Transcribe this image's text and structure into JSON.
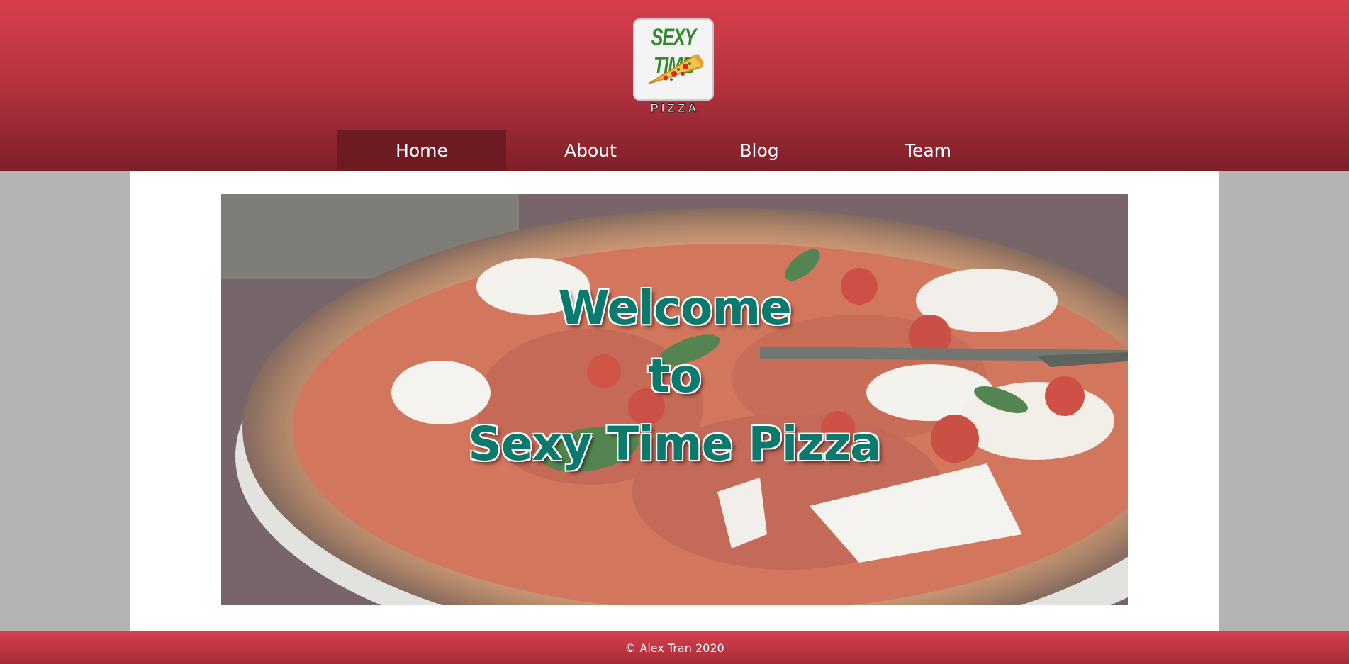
{
  "logo": {
    "top_text": "SEXY TIME",
    "bottom_text": "PIZZA"
  },
  "nav": {
    "items": [
      {
        "label": "Home",
        "active": true
      },
      {
        "label": "About",
        "active": false
      },
      {
        "label": "Blog",
        "active": false
      },
      {
        "label": "Team",
        "active": false
      }
    ]
  },
  "hero": {
    "line1": "Welcome",
    "line2": "to",
    "line3": "Sexy Time Pizza"
  },
  "footer": {
    "copyright": "© Alex Tran 2020"
  },
  "colors": {
    "header_top": "#d83f4c",
    "header_bottom": "#7e1f28",
    "nav_active": "#6e1a22",
    "hero_text": "#0b7a6c",
    "page_bg": "#b3b3b3"
  }
}
